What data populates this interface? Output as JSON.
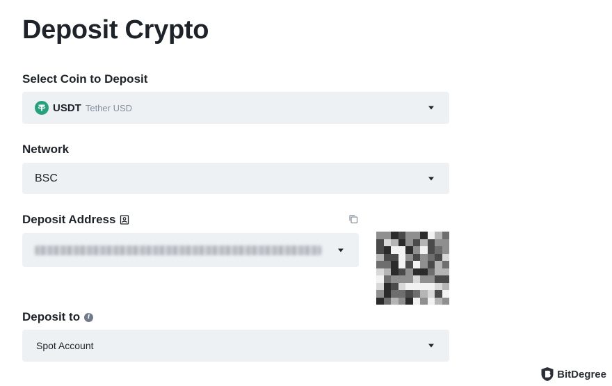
{
  "header": {
    "title": "Deposit Crypto"
  },
  "coin": {
    "label": "Select Coin to Deposit",
    "symbol": "USDT",
    "name": "Tether USD",
    "icon": "tether-icon",
    "icon_color": "#26a17b"
  },
  "network": {
    "label": "Network",
    "value": "BSC"
  },
  "address": {
    "label": "Deposit Address",
    "icons": [
      "address-book-icon",
      "copy-icon",
      "chevron-down-icon"
    ],
    "value_hidden": true
  },
  "deposit_to": {
    "label": "Deposit to",
    "value": "Spot Account",
    "icon": "info-icon"
  },
  "watermark": {
    "text": "BitDegree"
  },
  "colors": {
    "field_bg": "#eef1f4",
    "text": "#1e2329",
    "muted": "#848e9c"
  }
}
